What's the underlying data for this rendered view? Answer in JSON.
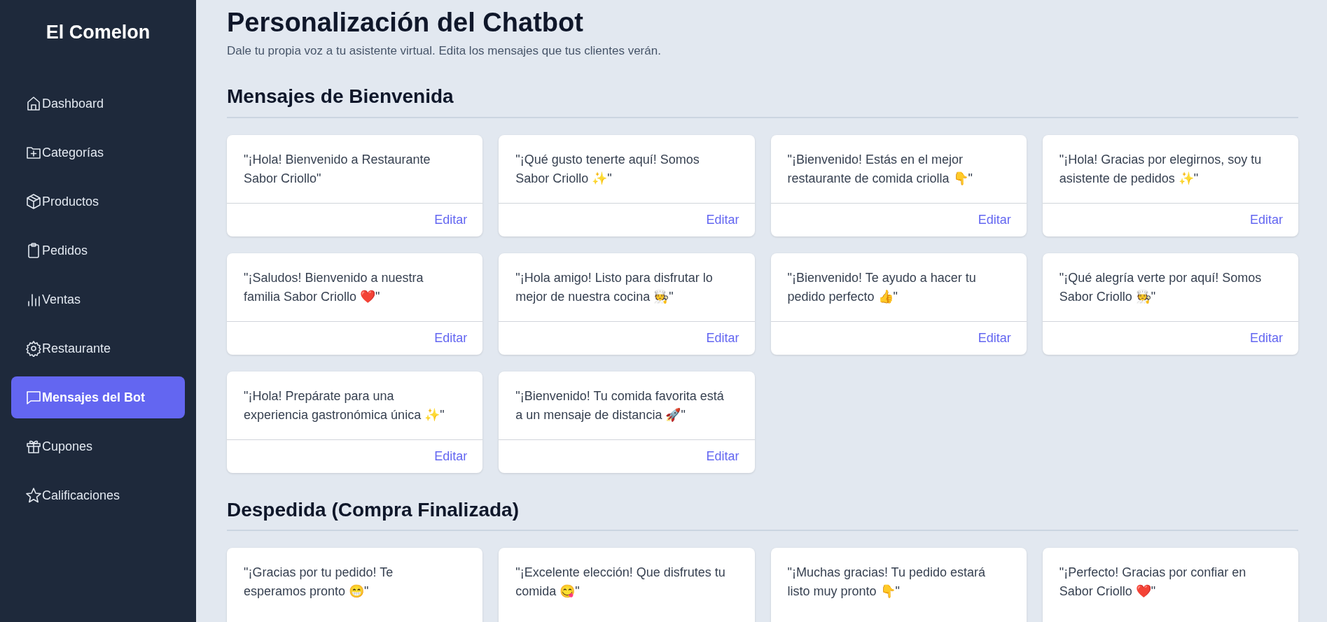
{
  "sidebar": {
    "brand": "El Comelon",
    "items": [
      {
        "label": "Dashboard",
        "selected": false
      },
      {
        "label": "Categorías",
        "selected": false
      },
      {
        "label": "Productos",
        "selected": false
      },
      {
        "label": "Pedidos",
        "selected": false
      },
      {
        "label": "Ventas",
        "selected": false
      },
      {
        "label": "Restaurante",
        "selected": false
      },
      {
        "label": "Mensajes del Bot",
        "selected": true
      },
      {
        "label": "Cupones",
        "selected": false
      },
      {
        "label": "Calificaciones",
        "selected": false
      }
    ]
  },
  "page": {
    "title": "Personalización del Chatbot",
    "subtitle": "Dale tu propia voz a tu asistente virtual. Edita los mensajes que tus clientes verán."
  },
  "sections": [
    {
      "title": "Mensajes de Bienvenida",
      "cards": [
        {
          "text": "\"¡Hola! Bienvenido a Restaurante Sabor Criollo\"",
          "action": "Editar"
        },
        {
          "text": "\"¡Qué gusto tenerte aquí! Somos Sabor Criollo ✨\"",
          "action": "Editar"
        },
        {
          "text": "\"¡Bienvenido! Estás en el mejor restaurante de comida criolla 👇\"",
          "action": "Editar"
        },
        {
          "text": "\"¡Hola! Gracias por elegirnos, soy tu asistente de pedidos ✨\"",
          "action": "Editar"
        },
        {
          "text": "\"¡Saludos! Bienvenido a nuestra familia Sabor Criollo ❤️\"",
          "action": "Editar"
        },
        {
          "text": "\"¡Hola amigo! Listo para disfrutar lo mejor de nuestra cocina 🧑‍🍳\"",
          "action": "Editar"
        },
        {
          "text": "\"¡Bienvenido! Te ayudo a hacer tu pedido perfecto 👍\"",
          "action": "Editar"
        },
        {
          "text": "\"¡Qué alegría verte por aquí! Somos Sabor Criollo 🧑‍🍳\"",
          "action": "Editar"
        },
        {
          "text": "\"¡Hola! Prepárate para una experiencia gastronómica única ✨\"",
          "action": "Editar"
        },
        {
          "text": "\"¡Bienvenido! Tu comida favorita está a un mensaje de distancia 🚀\"",
          "action": "Editar"
        }
      ]
    },
    {
      "title": "Despedida (Compra Finalizada)",
      "cards": [
        {
          "text": "\"¡Gracias por tu pedido! Te esperamos pronto 😁\""
        },
        {
          "text": "\"¡Excelente elección! Que disfrutes tu comida 😋\""
        },
        {
          "text": "\"¡Muchas gracias! Tu pedido estará listo muy pronto 👇\""
        },
        {
          "text": "\"¡Perfecto! Gracias por confiar en Sabor Criollo ❤️\""
        }
      ]
    }
  ]
}
